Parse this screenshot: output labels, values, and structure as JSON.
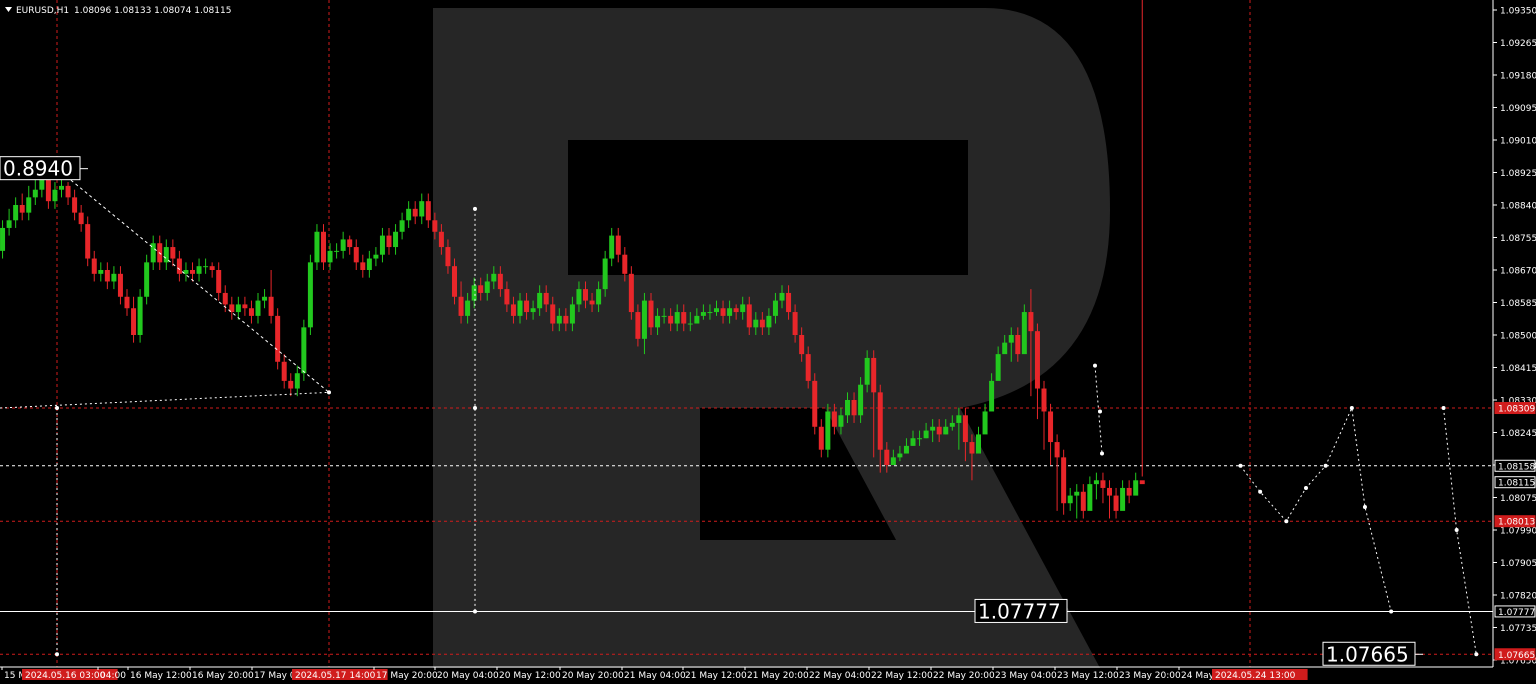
{
  "header": {
    "symbol_label": "EURUSD,H1",
    "ohlc_values": "1.08096 1.08133 1.08074 1.08115"
  },
  "colors": {
    "background": "#000000",
    "bull": "#22c81e",
    "bear": "#e8262a",
    "grid_red": "#d01c1c",
    "forecast": "#ffffff",
    "axis_text": "#ffffff",
    "watermark": "#262626"
  },
  "chart_data": {
    "type": "candlestick",
    "instrument": "EURUSD",
    "timeframe": "H1",
    "ylim": [
      1.0765,
      1.0935
    ],
    "y_ticks": [
      "1.09350",
      "1.09265",
      "1.09180",
      "1.09095",
      "1.09010",
      "1.08925",
      "1.08840",
      "1.08755",
      "1.08670",
      "1.08585",
      "1.08500",
      "1.08415",
      "1.08330",
      "1.08245",
      "1.08160",
      "1.08075",
      "1.07990",
      "1.07905",
      "1.07820",
      "1.07735",
      "1.07650"
    ],
    "x_ticks": [
      "15 M",
      "2024.05.16 03:00",
      "04:00",
      "16 May 12:00",
      "16 May 20:00",
      "17 May 04:00",
      "2024.05.17 14:00",
      "17 May 20:00",
      "20 May 04:00",
      "20 May 12:00",
      "20 May 20:00",
      "21 May 04:00",
      "21 May 12:00",
      "21 May 20:00",
      "22 May 04:00",
      "22 May 12:00",
      "22 May 20:00",
      "23 May 04:00",
      "23 May 12:00",
      "23 May 20:00",
      "24 May",
      "2024.05.24 13:00"
    ],
    "bars": [
      1,
      2,
      3,
      4,
      5,
      6,
      7,
      8,
      9,
      10,
      11,
      12,
      13,
      14,
      15,
      16,
      17,
      18,
      19,
      20,
      21,
      22,
      23,
      24,
      25,
      26,
      27,
      28,
      29,
      30,
      31,
      32,
      33,
      34,
      35,
      36,
      37,
      38,
      39,
      40,
      41,
      42,
      43,
      44,
      45,
      46,
      47,
      48,
      49,
      50,
      51,
      52,
      53,
      54,
      55,
      56,
      57,
      58,
      59,
      60,
      61,
      62,
      63,
      64,
      65,
      66,
      67,
      68,
      69,
      70,
      71,
      72,
      73,
      74,
      75,
      76,
      77,
      78,
      79,
      80,
      81,
      82,
      83,
      84,
      85,
      86,
      87,
      88,
      89,
      90,
      91,
      92,
      93,
      94,
      95,
      96,
      97,
      98,
      99,
      100,
      101,
      102,
      103,
      104,
      105,
      106,
      107,
      108,
      109,
      110,
      111,
      112,
      113,
      114,
      115,
      116,
      117,
      118,
      119,
      120,
      121,
      122,
      123,
      124,
      125,
      126,
      127,
      128,
      129,
      130,
      131,
      132,
      133,
      134,
      135,
      136,
      137,
      138,
      139,
      140,
      141,
      142,
      143,
      144,
      145,
      146,
      147,
      148,
      149,
      150,
      151,
      152,
      153,
      154,
      155,
      156,
      157,
      158,
      159,
      160,
      161,
      162,
      163,
      164,
      165,
      166,
      167,
      168,
      169,
      170,
      171,
      172,
      173,
      174,
      175,
      176,
      177,
      178,
      179,
      180,
      181,
      182,
      183,
      184,
      185,
      186,
      187,
      188,
      189,
      190
    ],
    "open": [
      1.0872,
      1.0878,
      1.088,
      1.0884,
      1.0882,
      1.0886,
      1.0888,
      1.0892,
      1.0885,
      1.0888,
      1.0889,
      1.0886,
      1.0882,
      1.0879,
      1.087,
      1.0866,
      1.0867,
      1.0864,
      1.0866,
      1.086,
      1.0857,
      1.085,
      1.086,
      1.0869,
      1.0874,
      1.0869,
      1.0873,
      1.087,
      1.0866,
      1.0867,
      1.0866,
      1.0868,
      1.0868,
      1.0867,
      1.0861,
      1.0858,
      1.0856,
      1.0858,
      1.0857,
      1.0855,
      1.0859,
      1.086,
      1.0855,
      1.0843,
      1.0838,
      1.0836,
      1.084,
      1.0852,
      1.0869,
      1.0877,
      1.0869,
      1.0872,
      1.0872,
      1.0875,
      1.0873,
      1.0869,
      1.0867,
      1.087,
      1.0871,
      1.0876,
      1.0873,
      1.0877,
      1.088,
      1.0883,
      1.0881,
      1.0885,
      1.088,
      1.0877,
      1.0873,
      1.0868,
      1.086,
      1.0855,
      1.0859,
      1.0863,
      1.0861,
      1.0864,
      1.0866,
      1.0862,
      1.0858,
      1.0855,
      1.0859,
      1.0856,
      1.0857,
      1.0861,
      1.0858,
      1.0853,
      1.0855,
      1.0853,
      1.0858,
      1.0862,
      1.0859,
      1.0858,
      1.0862,
      1.087,
      1.0876,
      1.0871,
      1.0866,
      1.0856,
      1.0849,
      1.0859,
      1.0852,
      1.0855,
      1.0855,
      1.0853,
      1.0856,
      1.0853,
      1.0853,
      1.0855,
      1.0856,
      1.0856,
      1.0857,
      1.0855,
      1.0857,
      1.0856,
      1.0858,
      1.0852,
      1.0854,
      1.0852,
      1.0855,
      1.0859,
      1.0861,
      1.0856,
      1.085,
      1.0845,
      1.0838,
      1.0826,
      1.082,
      1.083,
      1.0826,
      1.0829,
      1.0833,
      1.0829,
      1.0837,
      1.0844,
      1.0835,
      1.082,
      1.0816,
      1.0818,
      1.0819,
      1.0821,
      1.0823,
      1.0823,
      1.0825,
      1.0826,
      1.0824,
      1.0826,
      1.0827,
      1.0829,
      1.0822,
      1.0819,
      1.0824,
      1.083,
      1.0838,
      1.0845,
      1.0848,
      1.085,
      1.0845,
      1.0856,
      1.0851,
      1.0836,
      1.083,
      1.0822,
      1.0818,
      1.0806,
      1.0808,
      1.0809,
      1.0804,
      1.0811,
      1.0812,
      1.081,
      1.0808,
      1.0804,
      1.081,
      1.0808,
      1.0812
    ],
    "close": [
      1.0878,
      1.088,
      1.0884,
      1.0882,
      1.0886,
      1.0888,
      1.0892,
      1.0885,
      1.0888,
      1.0889,
      1.0886,
      1.0882,
      1.0879,
      1.087,
      1.0866,
      1.0867,
      1.0864,
      1.0866,
      1.086,
      1.0857,
      1.085,
      1.086,
      1.0869,
      1.0874,
      1.0869,
      1.0873,
      1.087,
      1.0866,
      1.0867,
      1.0866,
      1.0868,
      1.0868,
      1.0867,
      1.0861,
      1.0858,
      1.0856,
      1.0858,
      1.0857,
      1.0855,
      1.0859,
      1.086,
      1.0855,
      1.0843,
      1.0838,
      1.0836,
      1.084,
      1.0852,
      1.0869,
      1.0877,
      1.0869,
      1.0872,
      1.0872,
      1.0875,
      1.0873,
      1.0869,
      1.0867,
      1.087,
      1.0871,
      1.0876,
      1.0873,
      1.0877,
      1.088,
      1.0883,
      1.0881,
      1.0885,
      1.088,
      1.0877,
      1.0873,
      1.0868,
      1.086,
      1.0855,
      1.0859,
      1.0863,
      1.0861,
      1.0864,
      1.0866,
      1.0862,
      1.0858,
      1.0855,
      1.0859,
      1.0856,
      1.0857,
      1.0861,
      1.0858,
      1.0853,
      1.0855,
      1.0853,
      1.0858,
      1.0862,
      1.0859,
      1.0858,
      1.0862,
      1.087,
      1.0876,
      1.0871,
      1.0866,
      1.0856,
      1.0849,
      1.0859,
      1.0852,
      1.0855,
      1.0855,
      1.0853,
      1.0856,
      1.0853,
      1.0853,
      1.0855,
      1.0856,
      1.0856,
      1.0857,
      1.0855,
      1.0857,
      1.0856,
      1.0858,
      1.0852,
      1.0854,
      1.0852,
      1.0855,
      1.0859,
      1.0861,
      1.0856,
      1.085,
      1.0845,
      1.0838,
      1.0826,
      1.082,
      1.083,
      1.0826,
      1.0829,
      1.0833,
      1.0829,
      1.0837,
      1.0844,
      1.0835,
      1.082,
      1.0816,
      1.0818,
      1.0819,
      1.0821,
      1.0823,
      1.0823,
      1.0825,
      1.0826,
      1.0824,
      1.0826,
      1.0827,
      1.0829,
      1.0822,
      1.0819,
      1.0824,
      1.083,
      1.0838,
      1.0845,
      1.0848,
      1.085,
      1.0845,
      1.0856,
      1.0851,
      1.0836,
      1.083,
      1.0822,
      1.0818,
      1.0806,
      1.0808,
      1.0809,
      1.0804,
      1.0811,
      1.0812,
      1.081,
      1.0808,
      1.0804,
      1.081,
      1.0808,
      1.0812,
      1.0811
    ],
    "high": [
      1.088,
      1.0883,
      1.0886,
      1.0887,
      1.0889,
      1.0891,
      1.0894,
      1.0893,
      1.089,
      1.0891,
      1.089,
      1.0888,
      1.0884,
      1.0881,
      1.0872,
      1.0869,
      1.0869,
      1.0868,
      1.0868,
      1.0862,
      1.086,
      1.0862,
      1.0871,
      1.0876,
      1.0876,
      1.0875,
      1.0875,
      1.0872,
      1.0869,
      1.0869,
      1.087,
      1.087,
      1.0869,
      1.0869,
      1.0863,
      1.086,
      1.086,
      1.086,
      1.0859,
      1.0861,
      1.0862,
      1.0867,
      1.0857,
      1.0845,
      1.084,
      1.0842,
      1.0854,
      1.0871,
      1.0879,
      1.0879,
      1.0874,
      1.0874,
      1.0877,
      1.0876,
      1.0875,
      1.0871,
      1.0872,
      1.0873,
      1.0878,
      1.0878,
      1.0879,
      1.0882,
      1.0885,
      1.0885,
      1.0887,
      1.0887,
      1.0882,
      1.0879,
      1.0875,
      1.087,
      1.0864,
      1.0861,
      1.0865,
      1.0865,
      1.0866,
      1.0868,
      1.0868,
      1.0864,
      1.086,
      1.0861,
      1.0861,
      1.0859,
      1.0863,
      1.0863,
      1.086,
      1.0857,
      1.0857,
      1.086,
      1.0864,
      1.0864,
      1.0861,
      1.0864,
      1.0872,
      1.0878,
      1.0878,
      1.0873,
      1.0868,
      1.0858,
      1.0861,
      1.0861,
      1.0857,
      1.0857,
      1.0857,
      1.0858,
      1.0858,
      1.0856,
      1.0857,
      1.0858,
      1.0858,
      1.0859,
      1.0859,
      1.0859,
      1.0858,
      1.086,
      1.086,
      1.0856,
      1.0856,
      1.0857,
      1.0861,
      1.0863,
      1.0863,
      1.0858,
      1.0852,
      1.0847,
      1.084,
      1.0828,
      1.0832,
      1.0832,
      1.0831,
      1.0835,
      1.0835,
      1.0839,
      1.0846,
      1.0846,
      1.0837,
      1.0822,
      1.082,
      1.0821,
      1.0823,
      1.0825,
      1.0825,
      1.0827,
      1.0828,
      1.0828,
      1.0828,
      1.0829,
      1.0831,
      1.0831,
      1.0824,
      1.0826,
      1.0832,
      1.084,
      1.0847,
      1.085,
      1.0852,
      1.0852,
      1.0858,
      1.0862,
      1.0853,
      1.0838,
      1.0832,
      1.0824,
      1.082,
      1.081,
      1.0811,
      1.0811,
      1.0813,
      1.0814,
      1.0814,
      1.0812,
      1.081,
      1.0812,
      1.0812,
      1.0814,
      1.0813
    ],
    "low": [
      1.087,
      1.0876,
      1.0878,
      1.088,
      1.088,
      1.0884,
      1.0886,
      1.0883,
      1.0883,
      1.0886,
      1.0884,
      1.088,
      1.0877,
      1.0868,
      1.0864,
      1.0864,
      1.0862,
      1.0862,
      1.0858,
      1.0855,
      1.0848,
      1.0848,
      1.0858,
      1.0867,
      1.0867,
      1.0867,
      1.0868,
      1.0864,
      1.0864,
      1.0864,
      1.0864,
      1.0866,
      1.0865,
      1.0859,
      1.0856,
      1.0854,
      1.0854,
      1.0855,
      1.0853,
      1.0853,
      1.0857,
      1.0853,
      1.0841,
      1.0836,
      1.0834,
      1.0834,
      1.0838,
      1.085,
      1.0867,
      1.0867,
      1.0867,
      1.087,
      1.087,
      1.0871,
      1.0867,
      1.0865,
      1.0865,
      1.0868,
      1.0869,
      1.0871,
      1.0871,
      1.0875,
      1.0878,
      1.0879,
      1.0879,
      1.0878,
      1.0875,
      1.0871,
      1.0866,
      1.0858,
      1.0853,
      1.0853,
      1.0857,
      1.0859,
      1.0859,
      1.0862,
      1.086,
      1.0856,
      1.0853,
      1.0853,
      1.0854,
      1.0854,
      1.0855,
      1.0856,
      1.0851,
      1.0851,
      1.0851,
      1.0851,
      1.0856,
      1.0857,
      1.0856,
      1.0856,
      1.086,
      1.0868,
      1.0869,
      1.0864,
      1.0854,
      1.0847,
      1.0845,
      1.085,
      1.085,
      1.0853,
      1.0851,
      1.0851,
      1.0851,
      1.0851,
      1.0853,
      1.0854,
      1.0854,
      1.0855,
      1.0853,
      1.0853,
      1.0854,
      1.0854,
      1.085,
      1.085,
      1.085,
      1.085,
      1.0853,
      1.0857,
      1.0854,
      1.0848,
      1.0843,
      1.0836,
      1.0824,
      1.0818,
      1.0818,
      1.0824,
      1.0824,
      1.0827,
      1.0827,
      1.0827,
      1.0835,
      1.0818,
      1.0814,
      1.0814,
      1.0816,
      1.0817,
      1.0819,
      1.0821,
      1.0821,
      1.0823,
      1.0822,
      1.0822,
      1.0824,
      1.0825,
      1.082,
      1.0817,
      1.0812,
      1.0822,
      1.0828,
      1.0836,
      1.0843,
      1.0846,
      1.0843,
      1.0843,
      1.0849,
      1.0834,
      1.0828,
      1.082,
      1.0816,
      1.0804,
      1.0803,
      1.0804,
      1.0802,
      1.0802,
      1.0809,
      1.0807,
      1.0806,
      1.0802,
      1.0802,
      1.0806,
      1.0806,
      1.0809
    ],
    "horizontal_levels": [
      {
        "price": 1.08309,
        "label": "1.08309",
        "style": "red-dash",
        "tag": true
      },
      {
        "price": 1.08158,
        "label": "1.08158",
        "style": "white-dash",
        "tag": true
      },
      {
        "price": 1.08115,
        "label": "1.08115",
        "style": "none",
        "tag": true
      },
      {
        "price": 1.08013,
        "label": "1.08013",
        "style": "red-dash",
        "tag": true
      },
      {
        "price": 1.07777,
        "label": "1.07777",
        "style": "white-solid",
        "tag": true
      },
      {
        "price": 1.07665,
        "label": "1.07665",
        "style": "red-dash",
        "tag": true
      }
    ],
    "annotations": [
      {
        "text": "0.8940",
        "price": 1.08935,
        "anchor": "left"
      },
      {
        "text": "1.07777",
        "price": 1.07777,
        "anchor": "mid"
      },
      {
        "text": "1.07665",
        "price": 1.07665,
        "anchor": "right"
      }
    ],
    "forecast_path_a": [
      [
        190,
        1.08158
      ],
      [
        193,
        1.0809
      ],
      [
        197,
        1.08013
      ],
      [
        200,
        1.081
      ],
      [
        203,
        1.08158
      ],
      [
        207,
        1.08309
      ],
      [
        209,
        1.0805
      ],
      [
        213,
        1.07777
      ]
    ],
    "forecast_path_b": [
      [
        221,
        1.08309
      ],
      [
        223,
        1.0799
      ],
      [
        226,
        1.07665
      ]
    ]
  }
}
